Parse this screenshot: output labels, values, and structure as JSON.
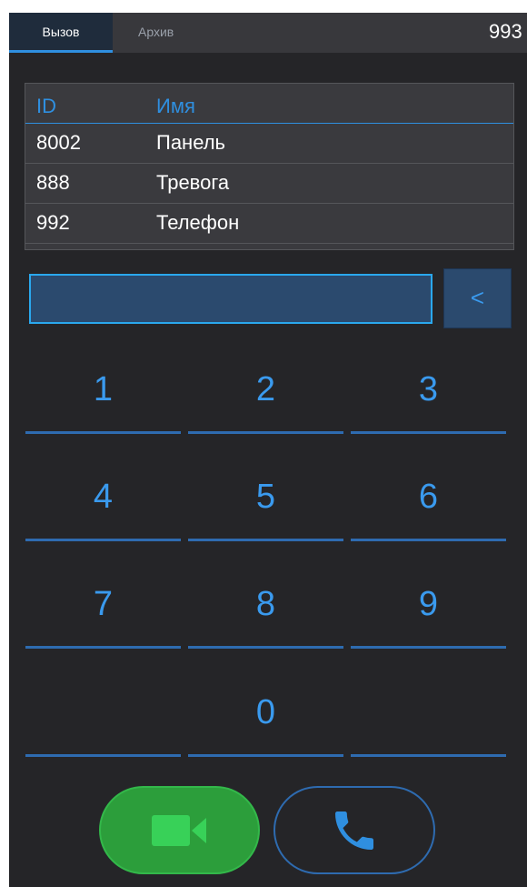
{
  "tabs": {
    "call_label": "Вызов",
    "archive_label": "Архив",
    "extension": "993"
  },
  "contacts": {
    "headers": {
      "id": "ID",
      "name": "Имя"
    },
    "rows": [
      {
        "id": "8002",
        "name": "Панель"
      },
      {
        "id": "888",
        "name": "Тревога"
      },
      {
        "id": "992",
        "name": "Телефон"
      }
    ]
  },
  "dial": {
    "input_value": "",
    "backspace_label": "<"
  },
  "keypad": {
    "keys": [
      "1",
      "2",
      "3",
      "4",
      "5",
      "6",
      "7",
      "8",
      "9",
      "0"
    ]
  },
  "actions": {
    "video_icon": "video-camera-icon",
    "audio_icon": "phone-handset-icon"
  },
  "colors": {
    "accent": "#2f8fe0",
    "video_button": "#2c9e3b",
    "background": "#252528"
  }
}
